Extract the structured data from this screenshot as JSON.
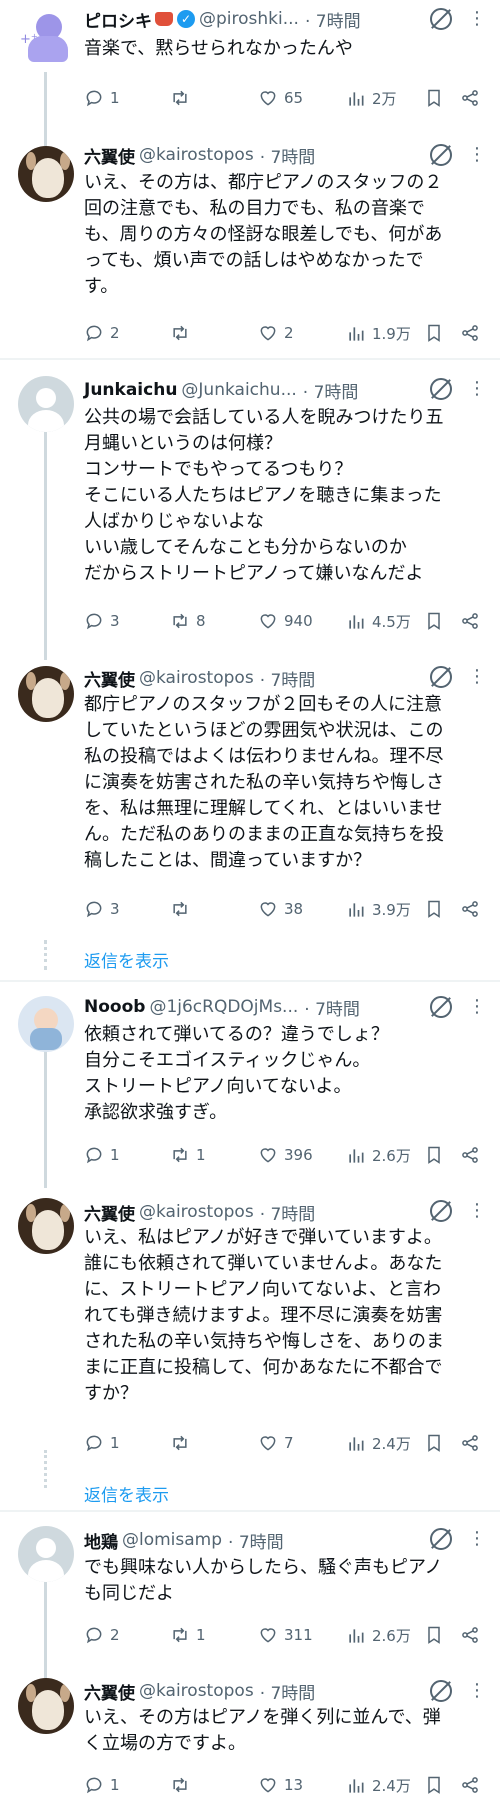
{
  "tweets": [
    {
      "name": "ピロシキ",
      "handle": "@piroshki...",
      "time": "· 7時間",
      "text": "音楽で、黙らせられなかったんや",
      "replies": "1",
      "reposts": "",
      "likes": "65",
      "views": "2万"
    },
    {
      "name": "六翼使",
      "handle": "@kairostopos",
      "time": "· 7時間",
      "text": "いえ、その方は、都庁ピアノのスタッフの２\n回の注意でも、私の目力でも、私の音楽で\nも、周りの方々の怪訝な眼差しでも、何があ\nっても、煩い声での話しはやめなかったで\nす。",
      "replies": "2",
      "reposts": "",
      "likes": "2",
      "views": "1.9万"
    },
    {
      "name": "Junkaichu",
      "handle": "@Junkaichu...",
      "time": "· 7時間",
      "text": "公共の場で会話している人を睨みつけたり五\n月蝿いというのは何様？\nコンサートでもやってるつもり？\nそこにいる人たちはピアノを聴きに集まった\n人ばかりじゃないよな\nいい歳してそんなことも分からないのか\nだからストリートピアノって嫌いなんだよ",
      "replies": "3",
      "reposts": "8",
      "likes": "940",
      "views": "4.5万"
    },
    {
      "name": "六翼使",
      "handle": "@kairostopos",
      "time": "· 7時間",
      "text": "都庁ピアノのスタッフが２回もその人に注意\nしていたというほどの雰囲気や状況は、この\n私の投稿ではよくは伝わりませんね。理不尽\nに演奏を妨害された私の辛い気持ちや悔しさ\nを、私は無理に理解してくれ、とはいいませ\nん。ただ私のありのままの正直な気持ちを投\n稿したことは、間違っていますか？",
      "replies": "3",
      "reposts": "",
      "likes": "38",
      "views": "3.9万"
    },
    {
      "name": "Nooob",
      "handle": "@1j6cRQDOjMs...",
      "time": "· 7時間",
      "text": "依頼されて弾いてるの？違うでしょ？\n自分こそエゴイスティックじゃん。\nストリートピアノ向いてないよ。\n承認欲求強すぎ。",
      "replies": "1",
      "reposts": "1",
      "likes": "396",
      "views": "2.6万"
    },
    {
      "name": "六翼使",
      "handle": "@kairostopos",
      "time": "· 7時間",
      "text": "いえ、私はピアノが好きで弾いていますよ。\n誰にも依頼されて弾いていませんよ。あなた\nに、ストリートピアノ向いてないよ、と言わ\nれても弾き続けますよ。理不尽に演奏を妨害\nされた私の辛い気持ちや悔しさを、ありのま\nまに正直に投稿して、何かあなたに不都合で\nすか？",
      "replies": "1",
      "reposts": "",
      "likes": "7",
      "views": "2.4万"
    },
    {
      "name": "地鶏",
      "handle": "@lomisamp",
      "time": "· 7時間",
      "text": "でも興味ない人からしたら、騒ぐ声もピアノ\nも同じだよ",
      "replies": "2",
      "reposts": "1",
      "likes": "311",
      "views": "2.6万"
    },
    {
      "name": "六翼使",
      "handle": "@kairostopos",
      "time": "· 7時間",
      "text": "いえ、その方はピアノを弾く列に並んで、弾\nく立場の方ですよ。",
      "replies": "1",
      "reposts": "",
      "likes": "13",
      "views": "2.4万"
    }
  ],
  "show_replies": "返信を表示",
  "icons": [
    "reply-icon",
    "repost-icon",
    "like-icon",
    "views-icon",
    "bookmark-icon",
    "share-icon",
    "grok-icon",
    "more-icon",
    "verified-icon"
  ]
}
